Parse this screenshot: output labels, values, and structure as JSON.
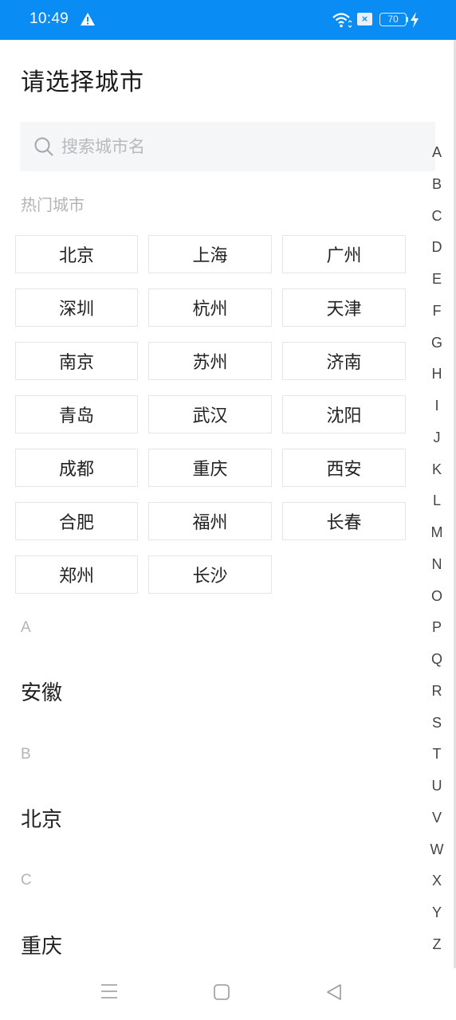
{
  "status_bar": {
    "time": "10:49",
    "sim_label": "×",
    "battery_level": "70",
    "icons": [
      "warning-icon",
      "wifi-icon",
      "sim-icon",
      "battery-icon",
      "charging-bolt-icon"
    ]
  },
  "header": {
    "title": "请选择城市"
  },
  "search": {
    "placeholder": "搜索城市名",
    "value": ""
  },
  "hot_cities": {
    "title": "热门城市",
    "items": [
      "北京",
      "上海",
      "广州",
      "深圳",
      "杭州",
      "天津",
      "南京",
      "苏州",
      "济南",
      "青岛",
      "武汉",
      "沈阳",
      "成都",
      "重庆",
      "西安",
      "合肥",
      "福州",
      "长春",
      "郑州",
      "长沙"
    ]
  },
  "sections": [
    {
      "letter": "A",
      "cities": [
        "安徽"
      ]
    },
    {
      "letter": "B",
      "cities": [
        "北京"
      ]
    },
    {
      "letter": "C",
      "cities": [
        "重庆"
      ]
    }
  ],
  "index_letters": [
    "A",
    "B",
    "C",
    "D",
    "E",
    "F",
    "G",
    "H",
    "I",
    "J",
    "K",
    "L",
    "M",
    "N",
    "O",
    "P",
    "Q",
    "R",
    "S",
    "T",
    "U",
    "V",
    "W",
    "X",
    "Y",
    "Z"
  ],
  "nav_bar": {
    "icons": [
      "menu-icon",
      "home-icon",
      "back-icon"
    ]
  },
  "colors": {
    "status_bar": "#0a8cf5",
    "search_bg": "#f4f6f8",
    "muted_text": "#b4b4b4",
    "border": "#e6e6e6"
  }
}
